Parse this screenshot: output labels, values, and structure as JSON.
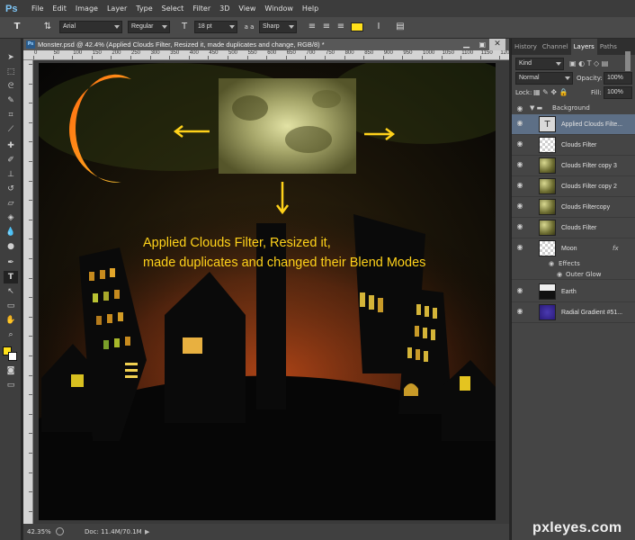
{
  "app": {
    "logo": "Ps"
  },
  "menu": [
    "File",
    "Edit",
    "Image",
    "Layer",
    "Type",
    "Select",
    "Filter",
    "3D",
    "View",
    "Window",
    "Help"
  ],
  "options": {
    "font_family": "Arial",
    "font_style": "Regular",
    "font_size": "18 pt",
    "aa_label": "a a",
    "anti_alias": "Sharp",
    "text_color": "#ffe01a"
  },
  "document": {
    "title": "Monster.psd @ 42.4% (Applied Clouds Filter, Resized it,  made duplicates and change, RGB/8) *",
    "ruler_labels": [
      "0",
      "50",
      "100",
      "150",
      "200",
      "250",
      "300",
      "350",
      "400",
      "450",
      "500",
      "550",
      "600",
      "650",
      "700",
      "750",
      "800",
      "850",
      "900",
      "950",
      "1000",
      "1050",
      "1100",
      "1150",
      "1200"
    ],
    "zoom": "42.35%",
    "doc_size": "Doc: 11.4M/70.1M"
  },
  "annotation": {
    "line1": "Applied Clouds Filter, Resized it,",
    "line2": "made duplicates and changed their Blend Modes",
    "color": "#ffd21a"
  },
  "panel": {
    "tabs": [
      "History",
      "Channel",
      "Layers",
      "Paths"
    ],
    "kind": "Kind",
    "blend_mode": "Normal",
    "opacity_label": "Opacity:",
    "opacity": "100%",
    "lock_label": "Lock:",
    "fill_label": "Fill:",
    "fill": "100%",
    "group": "Background",
    "layers": [
      {
        "name": "Applied Clouds Filte...",
        "type": "text"
      },
      {
        "name": "Clouds Filter",
        "type": "checker"
      },
      {
        "name": "Clouds Filter copy 3",
        "type": "clouds"
      },
      {
        "name": "Clouds Filter copy 2",
        "type": "clouds"
      },
      {
        "name": "Clouds Filtercopy",
        "type": "clouds"
      },
      {
        "name": "Clouds Filter",
        "type": "clouds"
      },
      {
        "name": "Moon",
        "type": "checker",
        "fx": "fx"
      },
      {
        "name": "Effects",
        "type": "effect"
      },
      {
        "name": "Outer Glow",
        "type": "effect"
      },
      {
        "name": "Earth",
        "type": "earth"
      },
      {
        "name": "Radial Gradient #51...",
        "type": "gradient"
      }
    ]
  },
  "watermark": "pxleyes.com"
}
